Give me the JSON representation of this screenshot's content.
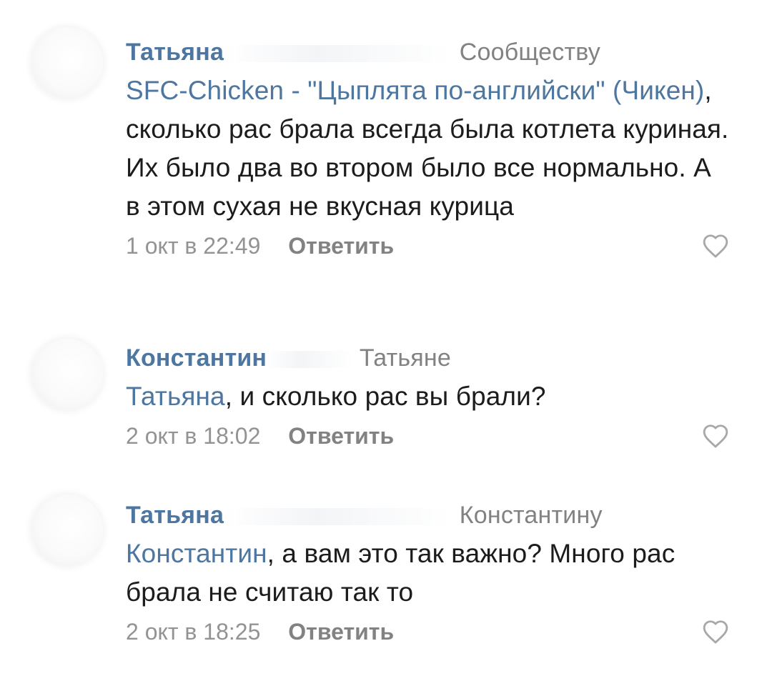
{
  "comments": [
    {
      "author": "Татьяна",
      "reply_to": "Сообществу",
      "link_text": "SFC-Chicken - \"Цыплята по-английски\" (Чикен)",
      "text": ", сколько рас брала всегда была котлета куриная. Их было два во втором было все нормально. А в этом сухая не вкусная курица",
      "date": "1 окт в 22:49",
      "reply_label": "Ответить"
    },
    {
      "author": "Константин",
      "reply_to": "Татьяне",
      "link_text": "Татьяна",
      "text": ", и сколько рас вы брали?",
      "date": "2 окт в 18:02",
      "reply_label": "Ответить"
    },
    {
      "author": "Татьяна",
      "reply_to": "Константину",
      "link_text": "Константин",
      "text": ", а вам это так важно? Много рас брала не считаю так то",
      "date": "2 окт в 18:25",
      "reply_label": "Ответить"
    }
  ],
  "icons": {
    "like": "heart-outline-icon",
    "avatar": "user-avatar-blurred"
  },
  "colors": {
    "link": "#4d76a1",
    "meta": "#939393",
    "reply_button": "#828282",
    "icon": "#a8a8a8"
  }
}
